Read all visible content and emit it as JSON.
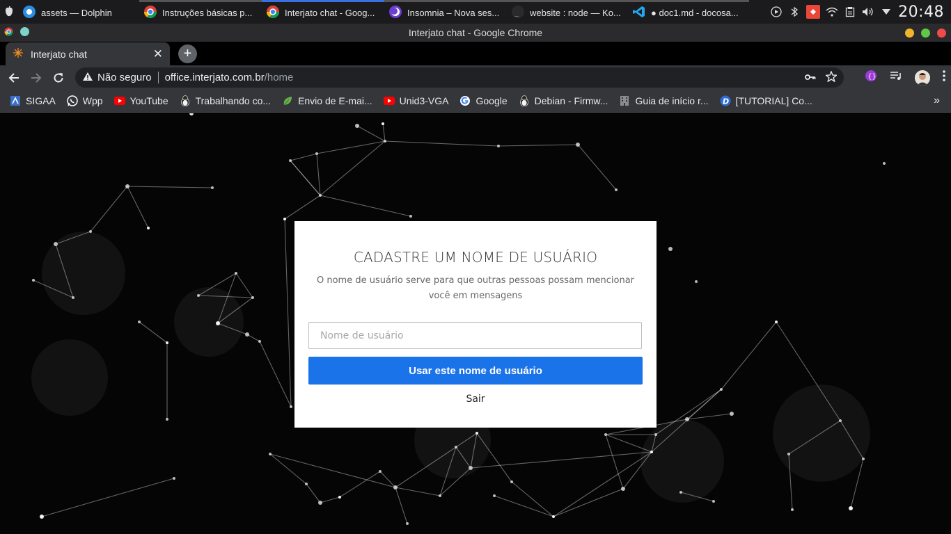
{
  "taskbar": {
    "tasks": [
      {
        "label": "assets — Dolphin",
        "icon": "dolphin-icon"
      },
      {
        "label": "Instruções básicas p...",
        "icon": "chrome-icon"
      },
      {
        "label": "Interjato chat - Goog...",
        "icon": "chrome-icon"
      },
      {
        "label": "Insomnia – Nova ses...",
        "icon": "insomnia-icon"
      },
      {
        "label": "website : node — Ko...",
        "icon": "konsole-icon"
      },
      {
        "label": "● doc1.md - docosa...",
        "icon": "vscode-icon"
      }
    ],
    "clock": "20:48"
  },
  "window": {
    "title": "Interjato chat - Google Chrome"
  },
  "browser": {
    "tab_title": "Interjato chat",
    "security_label": "Não seguro",
    "url_host": "office.interjato.com.br",
    "url_path": "/home"
  },
  "bookmarks": [
    {
      "label": "SIGAA",
      "icon": "sigaa-icon"
    },
    {
      "label": "Wpp",
      "icon": "whatsapp-icon"
    },
    {
      "label": "YouTube",
      "icon": "youtube-icon"
    },
    {
      "label": "Trabalhando co...",
      "icon": "tux-icon"
    },
    {
      "label": "Envio de E-mai...",
      "icon": "leaf-icon"
    },
    {
      "label": "Unid3-VGA",
      "icon": "youtube-icon"
    },
    {
      "label": "Google",
      "icon": "google-icon"
    },
    {
      "label": "Debian - Firmw...",
      "icon": "tux-icon"
    },
    {
      "label": "Guia de início r...",
      "icon": "building-icon"
    },
    {
      "label": "[TUTORIAL] Co...",
      "icon": "d-logo-icon"
    }
  ],
  "card": {
    "title": "CADASTRE UM NOME DE USUÁRIO",
    "subtitle": "O nome de usuário serve para que outras pessoas possam mencionar você em mensagens",
    "input_placeholder": "Nome de usuário",
    "input_value": "",
    "submit_label": "Usar este nome de usuário",
    "logout_label": "Sair"
  },
  "colors": {
    "primary_button": "#1a73e8",
    "active_task": "#3b6fe0",
    "page_background": "#050505"
  }
}
